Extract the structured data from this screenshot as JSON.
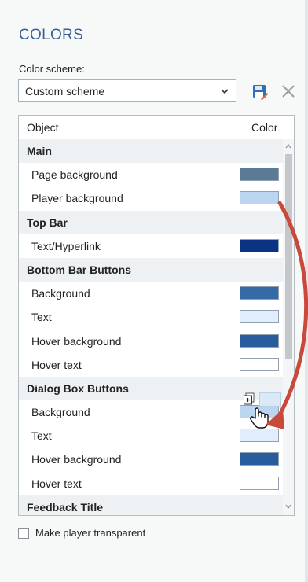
{
  "panel": {
    "title": "COLORS"
  },
  "scheme": {
    "label": "Color scheme:",
    "value": "Custom scheme"
  },
  "grid": {
    "header_object": "Object",
    "header_color": "Color",
    "rows": [
      {
        "type": "group",
        "label": "Main"
      },
      {
        "type": "item",
        "label": "Page background",
        "color": "#5b7a96"
      },
      {
        "type": "item",
        "label": "Player background",
        "color": "#bcd6f2"
      },
      {
        "type": "group",
        "label": "Top Bar"
      },
      {
        "type": "item",
        "label": "Text/Hyperlink",
        "color": "#0a3384"
      },
      {
        "type": "group",
        "label": "Bottom Bar Buttons"
      },
      {
        "type": "item",
        "label": "Background",
        "color": "#346ba7"
      },
      {
        "type": "item",
        "label": "Text",
        "color": "#e1edfb"
      },
      {
        "type": "item",
        "label": "Hover background",
        "color": "#275d9c"
      },
      {
        "type": "item",
        "label": "Hover text",
        "color": "#ffffff"
      },
      {
        "type": "group",
        "label": "Dialog Box Buttons"
      },
      {
        "type": "item",
        "label": "Background",
        "color": "#bcd6f2"
      },
      {
        "type": "item",
        "label": "Text",
        "color": "#e1edfb"
      },
      {
        "type": "item",
        "label": "Hover background",
        "color": "#275d9c"
      },
      {
        "type": "item",
        "label": "Hover text",
        "color": "#ffffff"
      },
      {
        "type": "group",
        "label": "Feedback Title"
      }
    ]
  },
  "transparent_option": {
    "label": "Make player transparent",
    "checked": false
  },
  "colors": {
    "accent": "#3a5f95",
    "annotation_arrow": "#c94a3a"
  }
}
